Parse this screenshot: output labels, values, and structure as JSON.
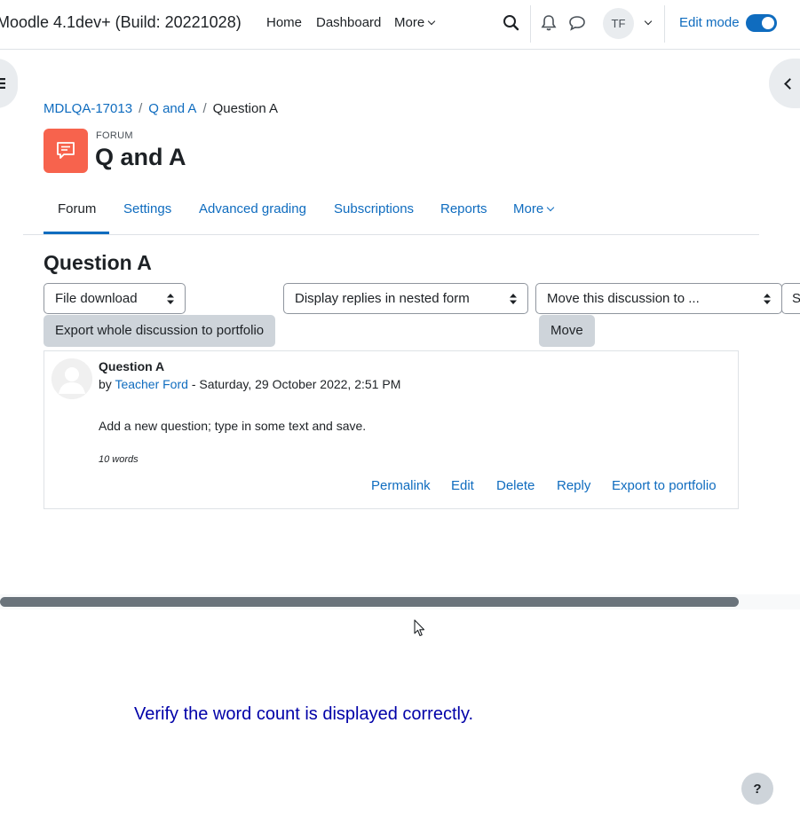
{
  "navbar": {
    "brand": "Moodle 4.1dev+ (Build: 20221028)",
    "links": [
      "Home",
      "Dashboard",
      "More"
    ],
    "avatar_initials": "TF",
    "edit_mode_label": "Edit mode",
    "edit_mode_on": true
  },
  "breadcrumb": {
    "items": [
      "MDLQA-17013",
      "Q and A",
      "Question A"
    ],
    "separator": "/"
  },
  "activity": {
    "type_label": "FORUM",
    "title": "Q and A",
    "icon_color": "#f7634d"
  },
  "tabs": {
    "items": [
      "Forum",
      "Settings",
      "Advanced grading",
      "Subscriptions",
      "Reports",
      "More"
    ],
    "active": "Forum"
  },
  "discussion": {
    "title": "Question A",
    "file_download_select": "File download",
    "display_mode_select": "Display replies in nested form",
    "move_select": "Move this discussion to ...",
    "overflow_select_fragment": "S",
    "export_button": "Export whole discussion to portfolio",
    "move_button": "Move"
  },
  "post": {
    "subject": "Question A",
    "by_prefix": "by",
    "author": "Teacher Ford",
    "date": "- Saturday, 29 October 2022, 2:51 PM",
    "body": "Add a new question; type in some text and save.",
    "word_count": "10 words",
    "actions": [
      "Permalink",
      "Edit",
      "Delete",
      "Reply",
      "Export to portfolio"
    ]
  },
  "caption": "Verify the word count is displayed correctly.",
  "help_label": "?",
  "colors": {
    "primary": "#0f6cbf",
    "caption": "#0000a8",
    "button_secondary": "#ced4da"
  },
  "icons": [
    "search-icon",
    "bell-icon",
    "chat-icon",
    "chevron-down-icon",
    "drawer-left-icon",
    "chevron-left-icon",
    "forum-icon",
    "user-avatar-icon",
    "mouse-cursor-icon"
  ]
}
